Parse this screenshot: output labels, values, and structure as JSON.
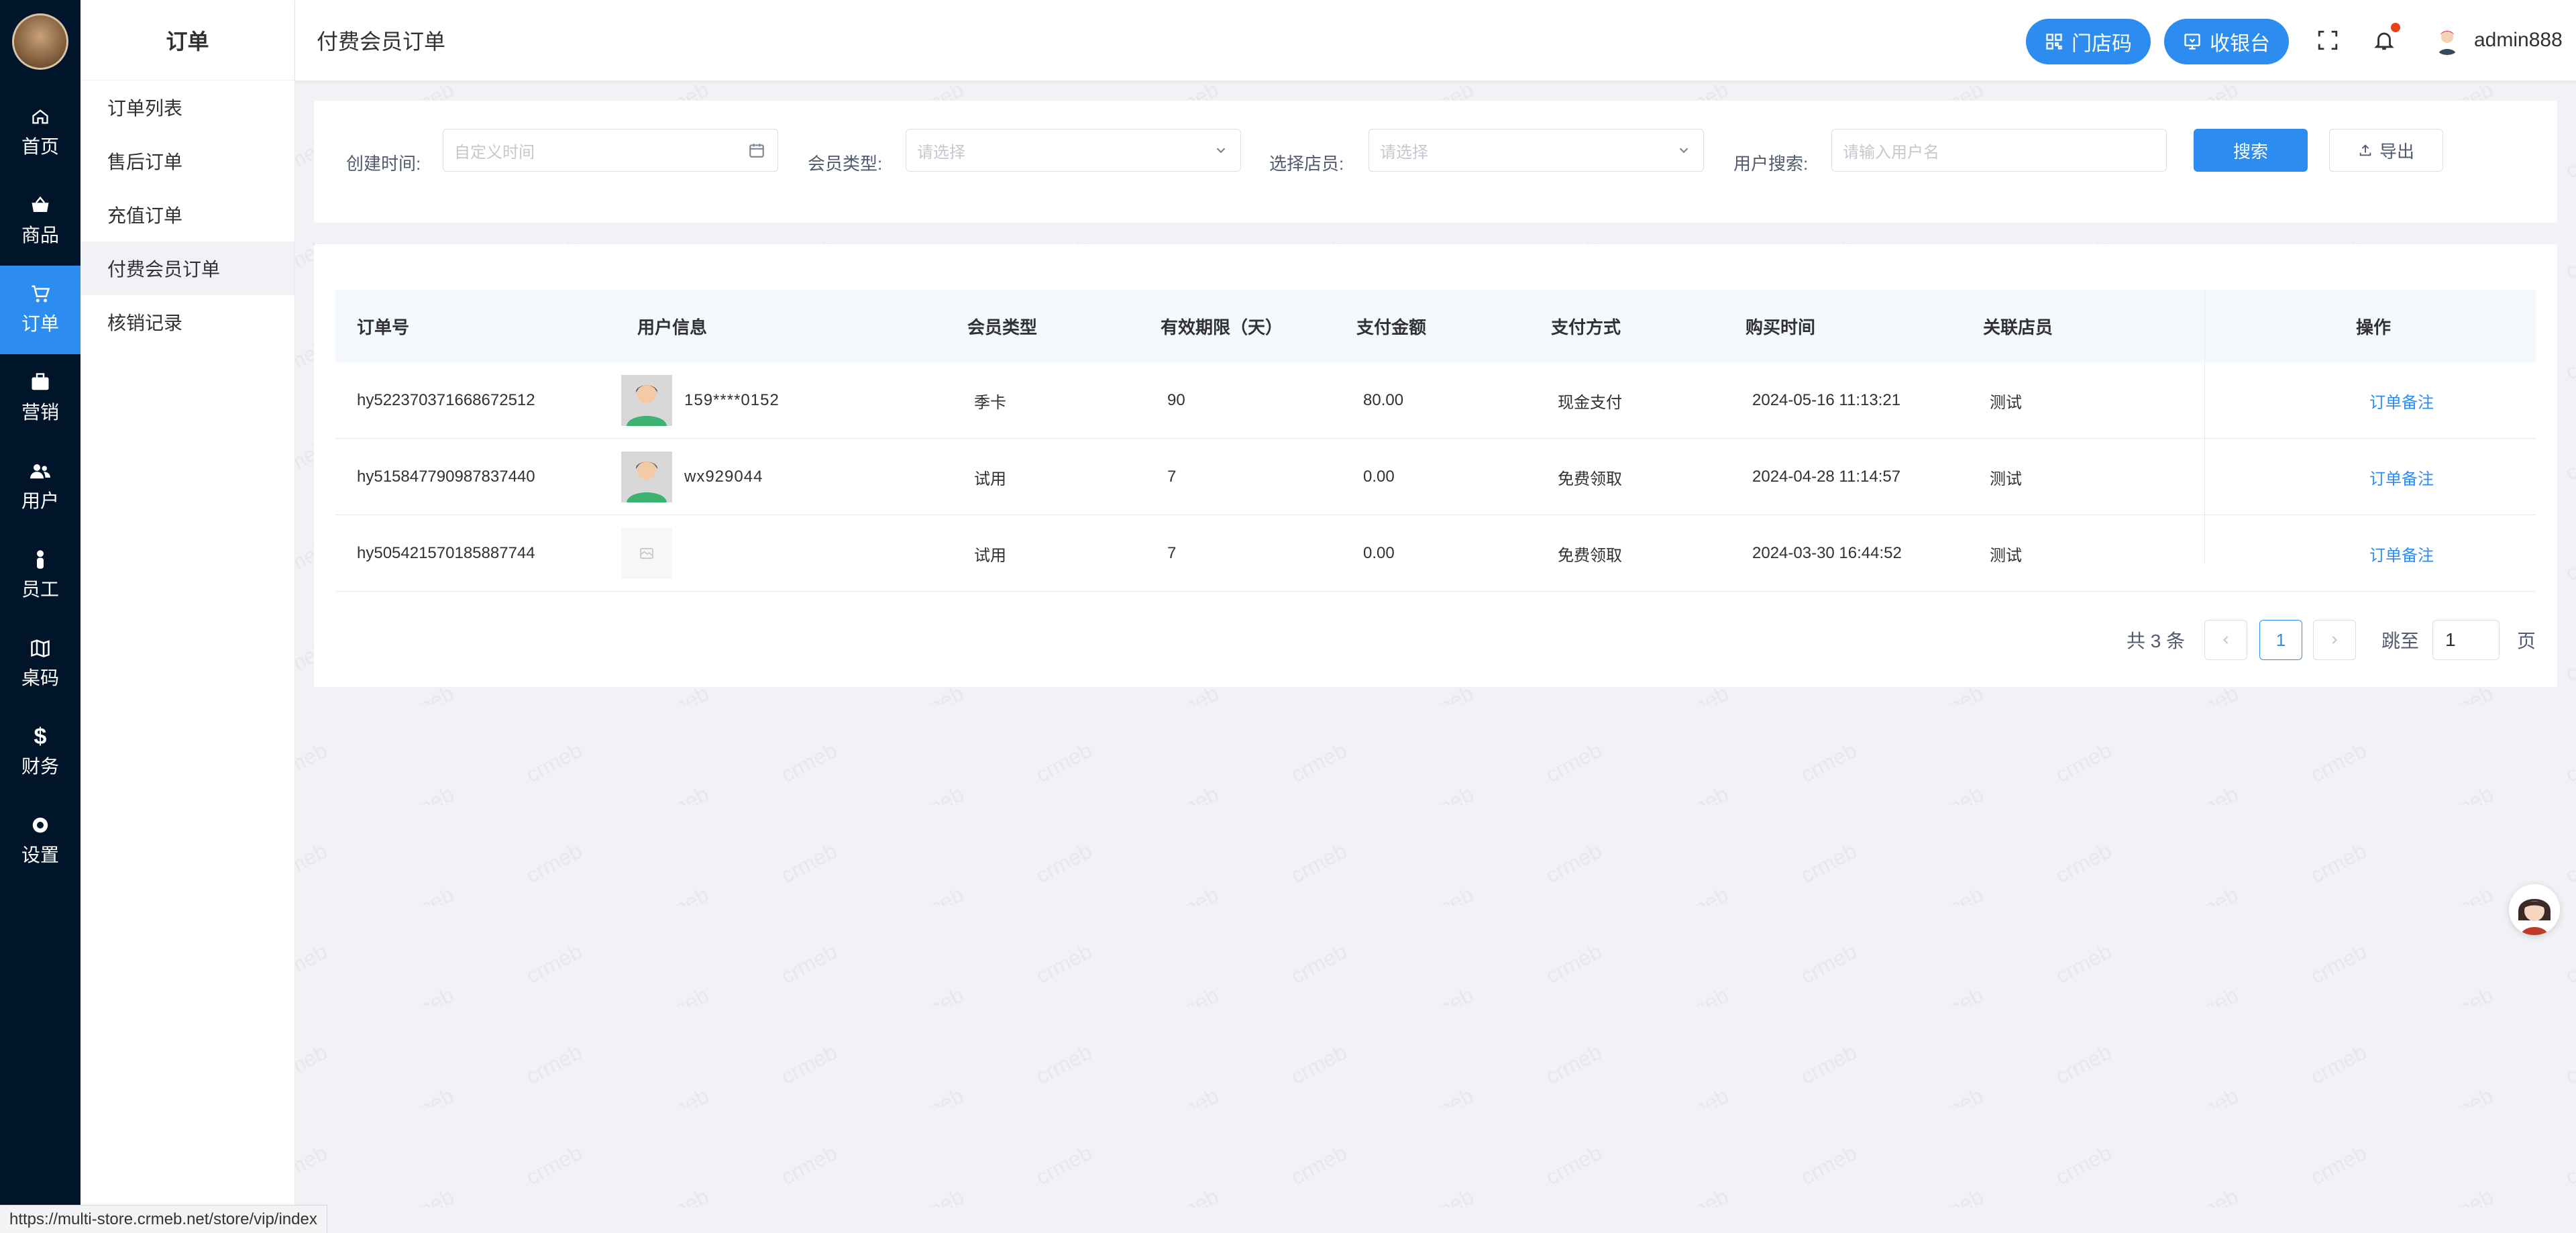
{
  "rail": {
    "items": [
      {
        "label": "首页",
        "icon": "home-icon"
      },
      {
        "label": "商品",
        "icon": "basket-icon"
      },
      {
        "label": "订单",
        "icon": "cart-icon"
      },
      {
        "label": "营销",
        "icon": "briefcase-icon"
      },
      {
        "label": "用户",
        "icon": "users-icon"
      },
      {
        "label": "员工",
        "icon": "person-icon"
      },
      {
        "label": "桌码",
        "icon": "map-icon"
      },
      {
        "label": "财务",
        "icon": "dollar-icon"
      },
      {
        "label": "设置",
        "icon": "gear-icon"
      }
    ],
    "active_index": 2
  },
  "submenu": {
    "title": "订单",
    "items": [
      "订单列表",
      "售后订单",
      "充值订单",
      "付费会员订单",
      "核销记录"
    ],
    "active_index": 3
  },
  "header": {
    "title": "付费会员订单",
    "store_code_label": "门店码",
    "cashier_label": "收银台",
    "username": "admin888"
  },
  "filters": {
    "create_time_label": "创建时间:",
    "create_time_placeholder": "自定义时间",
    "member_type_label": "会员类型:",
    "member_type_placeholder": "请选择",
    "clerk_label": "选择店员:",
    "clerk_placeholder": "请选择",
    "user_search_label": "用户搜索:",
    "user_search_placeholder": "请输入用户名",
    "search_button": "搜索",
    "export_button": "导出"
  },
  "table": {
    "columns": [
      "订单号",
      "用户信息",
      "会员类型",
      "有效期限（天）",
      "支付金额",
      "支付方式",
      "购买时间",
      "关联店员",
      "操作"
    ],
    "rows": [
      {
        "order_no": "hy522370371668672512",
        "user": "159****0152",
        "member_type": "季卡",
        "days": "90",
        "amount": "80.00",
        "pay_method": "现金支付",
        "buy_time": "2024-05-16 11:13:21",
        "clerk": "测试",
        "action": "订单备注"
      },
      {
        "order_no": "hy515847790987837440",
        "user": "wx929044",
        "member_type": "试用",
        "days": "7",
        "amount": "0.00",
        "pay_method": "免费领取",
        "buy_time": "2024-04-28 11:14:57",
        "clerk": "测试",
        "action": "订单备注"
      },
      {
        "order_no": "hy505421570185887744",
        "user": "",
        "member_type": "试用",
        "days": "7",
        "amount": "0.00",
        "pay_method": "免费领取",
        "buy_time": "2024-03-30 16:44:52",
        "clerk": "测试",
        "action": "订单备注"
      }
    ]
  },
  "pagination": {
    "total_label": "共 3 条",
    "current_page": "1",
    "jump_label": "跳至",
    "jump_value": "1",
    "page_suffix": "页"
  },
  "watermark_text": "crmeb",
  "status_url": "https://multi-store.crmeb.net/store/vip/index",
  "colors": {
    "primary": "#2d8cf0",
    "rail_bg": "#001529",
    "page_bg": "#f0f2f5",
    "notification_dot": "#ed4014"
  }
}
